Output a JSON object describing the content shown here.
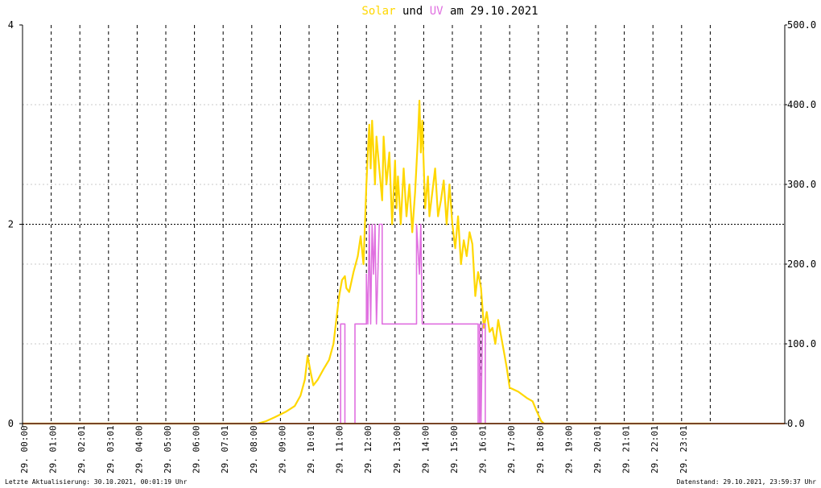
{
  "title": {
    "solar_label": "Solar",
    "connector": "und",
    "uv_label": "UV",
    "date_prefix": "am",
    "date": "29.10.2021",
    "solar_color": "#ffd700",
    "uv_color": "#e070e0"
  },
  "footer": {
    "last_update": "Letzte Aktualisierung: 30.10.2021, 00:01:19 Uhr",
    "data_state": "Datenstand: 29.10.2021, 23:59:37 Uhr"
  },
  "chart_data": {
    "type": "line",
    "grid": true,
    "y_left": {
      "min": 0,
      "max": 4,
      "ticks": [
        "0",
        "2",
        "4"
      ]
    },
    "y_right": {
      "min": 0,
      "max": 500,
      "ticks": [
        "0.0",
        "100.0",
        "200.0",
        "300.0",
        "400.0",
        "500.0"
      ]
    },
    "x_ticks": [
      "29. 00:00",
      "29. 01:00",
      "29. 02:01",
      "29. 03:01",
      "29. 04:00",
      "29. 05:00",
      "29. 06:00",
      "29. 07:01",
      "29. 08:00",
      "29. 09:00",
      "29. 10:01",
      "29. 11:00",
      "29. 12:00",
      "29. 13:00",
      "29. 14:00",
      "29. 15:00",
      "29. 16:01",
      "29. 17:00",
      "29. 18:00",
      "29. 19:00",
      "29. 20:01",
      "29. 21:01",
      "29. 22:01",
      "29. 23:01"
    ],
    "series": [
      {
        "name": "Solar",
        "axis": "right",
        "color": "#ffd700",
        "points": [
          [
            0.0,
            0
          ],
          [
            8.2,
            0
          ],
          [
            8.5,
            3
          ],
          [
            8.8,
            8
          ],
          [
            9.2,
            15
          ],
          [
            9.5,
            22
          ],
          [
            9.7,
            35
          ],
          [
            9.85,
            55
          ],
          [
            9.95,
            85
          ],
          [
            10.05,
            65
          ],
          [
            10.15,
            48
          ],
          [
            10.3,
            55
          ],
          [
            10.5,
            68
          ],
          [
            10.7,
            80
          ],
          [
            10.85,
            100
          ],
          [
            10.95,
            130
          ],
          [
            11.05,
            160
          ],
          [
            11.15,
            180
          ],
          [
            11.25,
            185
          ],
          [
            11.3,
            170
          ],
          [
            11.4,
            165
          ],
          [
            11.55,
            190
          ],
          [
            11.7,
            210
          ],
          [
            11.8,
            235
          ],
          [
            11.9,
            200
          ],
          [
            12.0,
            300
          ],
          [
            12.05,
            340
          ],
          [
            12.1,
            375
          ],
          [
            12.15,
            320
          ],
          [
            12.2,
            380
          ],
          [
            12.25,
            340
          ],
          [
            12.3,
            300
          ],
          [
            12.35,
            360
          ],
          [
            12.45,
            320
          ],
          [
            12.55,
            280
          ],
          [
            12.6,
            360
          ],
          [
            12.7,
            300
          ],
          [
            12.8,
            340
          ],
          [
            12.9,
            250
          ],
          [
            13.0,
            330
          ],
          [
            13.05,
            270
          ],
          [
            13.1,
            310
          ],
          [
            13.2,
            250
          ],
          [
            13.3,
            320
          ],
          [
            13.4,
            260
          ],
          [
            13.5,
            300
          ],
          [
            13.6,
            240
          ],
          [
            13.7,
            290
          ],
          [
            13.8,
            360
          ],
          [
            13.85,
            405
          ],
          [
            13.9,
            340
          ],
          [
            13.95,
            380
          ],
          [
            14.05,
            270
          ],
          [
            14.15,
            310
          ],
          [
            14.2,
            260
          ],
          [
            14.3,
            290
          ],
          [
            14.4,
            320
          ],
          [
            14.5,
            260
          ],
          [
            14.6,
            280
          ],
          [
            14.7,
            305
          ],
          [
            14.8,
            250
          ],
          [
            14.9,
            300
          ],
          [
            15.0,
            250
          ],
          [
            15.1,
            220
          ],
          [
            15.2,
            260
          ],
          [
            15.3,
            200
          ],
          [
            15.4,
            230
          ],
          [
            15.5,
            210
          ],
          [
            15.6,
            240
          ],
          [
            15.7,
            225
          ],
          [
            15.8,
            160
          ],
          [
            15.9,
            190
          ],
          [
            16.0,
            170
          ],
          [
            16.1,
            120
          ],
          [
            16.2,
            140
          ],
          [
            16.3,
            115
          ],
          [
            16.4,
            120
          ],
          [
            16.5,
            100
          ],
          [
            16.6,
            130
          ],
          [
            16.7,
            110
          ],
          [
            16.8,
            90
          ],
          [
            16.9,
            70
          ],
          [
            17.0,
            45
          ],
          [
            17.3,
            40
          ],
          [
            17.6,
            32
          ],
          [
            17.8,
            28
          ],
          [
            17.95,
            15
          ],
          [
            18.1,
            3
          ],
          [
            18.2,
            0
          ],
          [
            24.0,
            0
          ]
        ]
      },
      {
        "name": "UV",
        "axis": "left",
        "color": "#e070e0",
        "points": [
          [
            0.0,
            0
          ],
          [
            11.1,
            0
          ],
          [
            11.1,
            1
          ],
          [
            11.25,
            1
          ],
          [
            11.25,
            0
          ],
          [
            11.6,
            0
          ],
          [
            11.6,
            1
          ],
          [
            12.0,
            1
          ],
          [
            12.0,
            1.5
          ],
          [
            12.05,
            1
          ],
          [
            12.1,
            2
          ],
          [
            12.15,
            1
          ],
          [
            12.2,
            2
          ],
          [
            12.25,
            1.5
          ],
          [
            12.3,
            2
          ],
          [
            12.35,
            1
          ],
          [
            12.45,
            2
          ],
          [
            12.55,
            2
          ],
          [
            12.55,
            1
          ],
          [
            13.75,
            1
          ],
          [
            13.75,
            2
          ],
          [
            13.85,
            1.5
          ],
          [
            13.9,
            2
          ],
          [
            13.95,
            1
          ],
          [
            15.9,
            1
          ],
          [
            15.9,
            0
          ],
          [
            15.95,
            0
          ],
          [
            15.95,
            1
          ],
          [
            16.0,
            0
          ],
          [
            16.05,
            1
          ],
          [
            16.15,
            1
          ],
          [
            16.15,
            0
          ],
          [
            24.0,
            0
          ]
        ]
      }
    ]
  }
}
